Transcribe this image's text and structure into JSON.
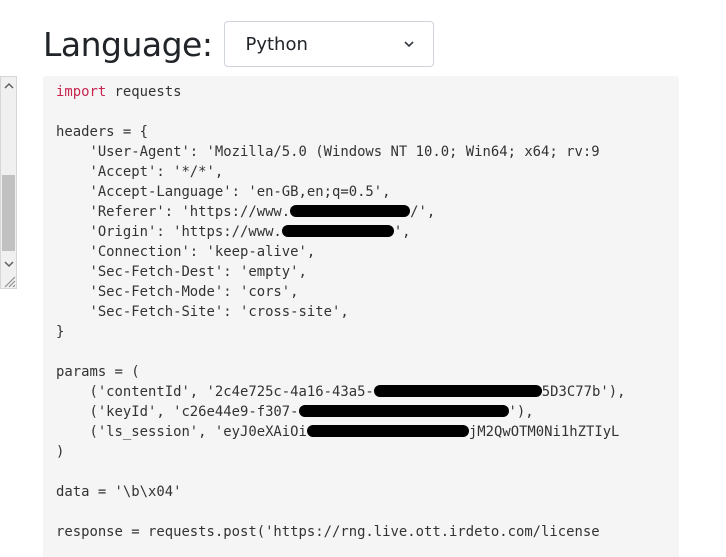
{
  "language": {
    "label": "Language:",
    "selected": "Python"
  },
  "code": {
    "lines": [
      {
        "keyword": "import",
        "text": " requests"
      },
      {
        "text": ""
      },
      {
        "text": "headers = {"
      },
      {
        "text": "    'User-Agent': 'Mozilla/5.0 (Windows NT 10.0; Win64; x64; rv:9"
      },
      {
        "text": "    'Accept': '*/*',"
      },
      {
        "text": "    'Accept-Language': 'en-GB,en;q=0.5',"
      },
      {
        "text": "    'Referer': 'https://www.",
        "redacted": true,
        "after": "/',"
      },
      {
        "text": "    'Origin': 'https://www.",
        "redacted": true,
        "after": "',"
      },
      {
        "text": "    'Connection': 'keep-alive',"
      },
      {
        "text": "    'Sec-Fetch-Dest': 'empty',"
      },
      {
        "text": "    'Sec-Fetch-Mode': 'cors',"
      },
      {
        "text": "    'Sec-Fetch-Site': 'cross-site',"
      },
      {
        "text": "}"
      },
      {
        "text": ""
      },
      {
        "text": "params = ("
      },
      {
        "text": "    ('contentId', '2c4e725c-4a16-43a5-",
        "redacted": true,
        "after": "5D3C77b'),"
      },
      {
        "text": "    ('keyId', 'c26e44e9-f307-",
        "redacted": true,
        "after": "'),"
      },
      {
        "text": "    ('ls_session', 'eyJ0eXAiOi",
        "redacted": true,
        "after": "jM2QwOTM0Ni1hZTIyL"
      },
      {
        "text": ")"
      },
      {
        "text": ""
      },
      {
        "text": "data = '\\b\\x04'"
      },
      {
        "text": ""
      },
      {
        "text": "response = requests.post('https://rng.live.ott.irdeto.com/license"
      }
    ]
  },
  "icons": {
    "select_arrow": "chevron-down-icon",
    "scroll_up": "scroll-up-arrow-icon",
    "scroll_down": "scroll-down-arrow-icon",
    "resize": "resize-grip-icon"
  }
}
